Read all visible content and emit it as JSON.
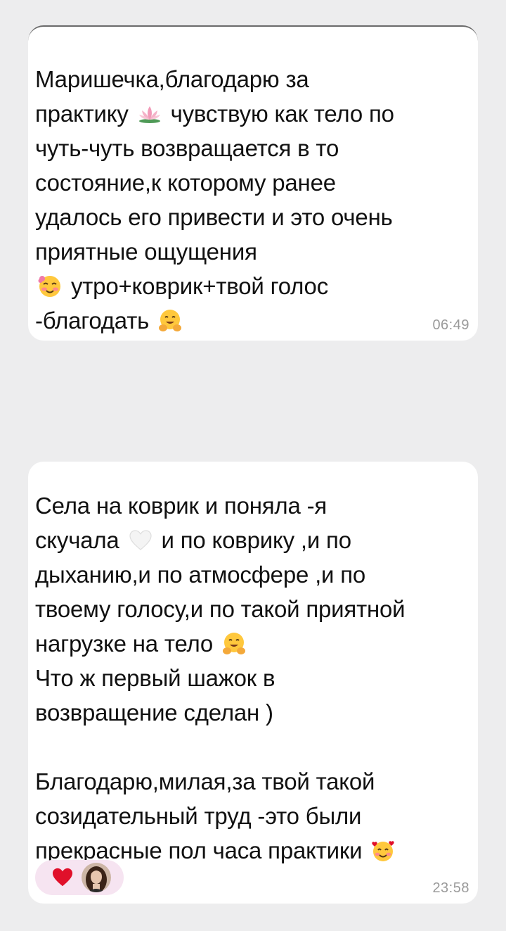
{
  "messages": [
    {
      "lines": [
        [
          "Маришечка,благодарю за"
        ],
        [
          "практику ",
          {
            "icon": "lotus-icon"
          },
          " чувствую как тело по"
        ],
        [
          "чуть-чуть возвращается в то"
        ],
        [
          "состояние,к которому ранее"
        ],
        [
          "удалось его привести и это очень"
        ],
        [
          "приятные ощущения"
        ],
        [
          {
            "icon": "flushed-smile-icon"
          },
          " утро+коврик+твой голос"
        ],
        [
          "-благодать ",
          {
            "icon": "hugging-face-icon"
          }
        ]
      ],
      "time": "06:49"
    },
    {
      "lines": [
        [
          "Села на коврик и поняла -я"
        ],
        [
          "скучала ",
          {
            "icon": "white-heart-icon"
          },
          " и по коврику ,и по"
        ],
        [
          "дыханию,и по атмосфере ,и по"
        ],
        [
          "твоему голосу,и по такой приятной"
        ],
        [
          "нагрузке на тело ",
          {
            "icon": "hugging-face-icon"
          }
        ],
        [
          "Что ж первый шажок в"
        ],
        [
          "возвращение сделан )"
        ],
        [],
        [
          "Благодарю,милая,за твой такой"
        ],
        [
          "созидательный труд -это были"
        ],
        [
          "прекрасные пол часа практики ",
          {
            "icon": "smiling-hearts-icon"
          }
        ]
      ],
      "time": "23:58",
      "reactions": [
        {
          "icon": "red-heart-icon"
        },
        {
          "icon": "avatar-photo"
        }
      ]
    }
  ],
  "colors": {
    "background": "#ededee",
    "bubble": "#ffffff",
    "text": "#111111",
    "timestamp": "#9a9a9a",
    "reaction_pill": "#f6e4f1",
    "heart": "#e0102a"
  }
}
